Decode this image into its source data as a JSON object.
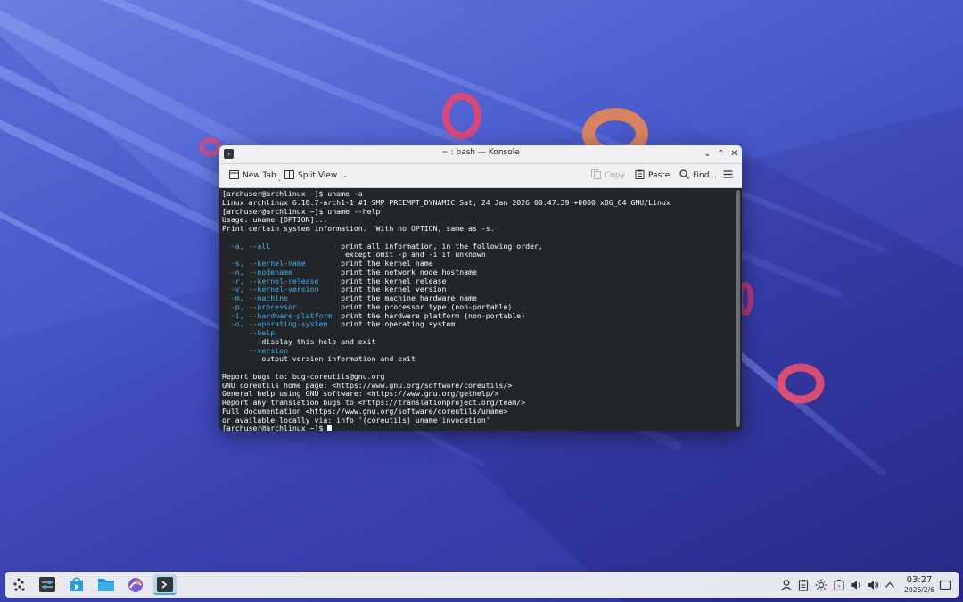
{
  "window": {
    "title": "~ : bash — Konsole",
    "buttons": {
      "minimize": "⌄",
      "maximize": "⌃",
      "close": "✕"
    }
  },
  "toolbar": {
    "new_tab": "New Tab",
    "split_view": "Split View",
    "copy": "Copy",
    "paste": "Paste",
    "find": "Find..."
  },
  "terminal": {
    "lines": [
      {
        "text": "[archuser@archlinux ~]$ uname -a"
      },
      {
        "text": "Linux archlinux 6.18.7-arch1-1 #1 SMP PREEMPT_DYNAMIC Sat, 24 Jan 2026 00:47:39 +0000 x86_64 GNU/Linux"
      },
      {
        "text": "[archuser@archlinux ~]$ uname --help"
      },
      {
        "text": "Usage: uname [OPTION]..."
      },
      {
        "text": "Print certain system information.  With no OPTION, same as -s."
      },
      {
        "text": ""
      },
      {
        "opt": "  -a, --all",
        "desc": "                print all information, in the following order,"
      },
      {
        "text": "                            except omit -p and -i if unknown"
      },
      {
        "opt": "  -s, --kernel-name",
        "desc": "        print the kernel name"
      },
      {
        "opt": "  -n, --nodename",
        "desc": "           print the network node hostname"
      },
      {
        "opt": "  -r, --kernel-release",
        "desc": "     print the kernel release"
      },
      {
        "opt": "  -v, --kernel-version",
        "desc": "     print the kernel version"
      },
      {
        "opt": "  -m, --machine",
        "desc": "            print the machine hardware name"
      },
      {
        "opt": "  -p, --processor",
        "desc": "          print the processor type (non-portable)"
      },
      {
        "opt": "  -i, --hardware-platform",
        "desc": "  print the hardware platform (non-portable)"
      },
      {
        "opt": "  -o, --operating-system",
        "desc": "   print the operating system"
      },
      {
        "opt": "      --help",
        "desc": ""
      },
      {
        "text": "         display this help and exit"
      },
      {
        "opt": "      --version",
        "desc": ""
      },
      {
        "text": "         output version information and exit"
      },
      {
        "text": ""
      },
      {
        "text": "Report bugs to: bug-coreutils@gnu.org"
      },
      {
        "text": "GNU coreutils home page: <https://www.gnu.org/software/coreutils/>"
      },
      {
        "text": "General help using GNU software: <https://www.gnu.org/gethelp/>"
      },
      {
        "text": "Report any translation bugs to <https://translationproject.org/team/>"
      },
      {
        "text": "Full documentation <https://www.gnu.org/software/coreutils/uname>"
      },
      {
        "text": "or available locally via: info '(coreutils) uname invocation'"
      }
    ],
    "prompt": "[archuser@archlinux ~]$ "
  },
  "taskbar": {
    "apps": [
      {
        "name": "application-launcher-icon"
      },
      {
        "name": "system-settings-icon"
      },
      {
        "name": "discover-store-icon"
      },
      {
        "name": "dolphin-files-icon"
      },
      {
        "name": "browser-icon"
      },
      {
        "name": "konsole-icon",
        "active": true
      }
    ],
    "tray": [
      "user-icon",
      "clipboard-icon",
      "brightness-icon",
      "battery-icon",
      "volume-icon",
      "volume-2-icon",
      "network-icon",
      "tray-expand-icon"
    ],
    "clock_time": "03:27",
    "clock_date": "2026/2/6"
  },
  "colors": {
    "accent": "#3daee9",
    "terminal_bg": "#232629",
    "terminal_fg": "#fcfcfc"
  }
}
